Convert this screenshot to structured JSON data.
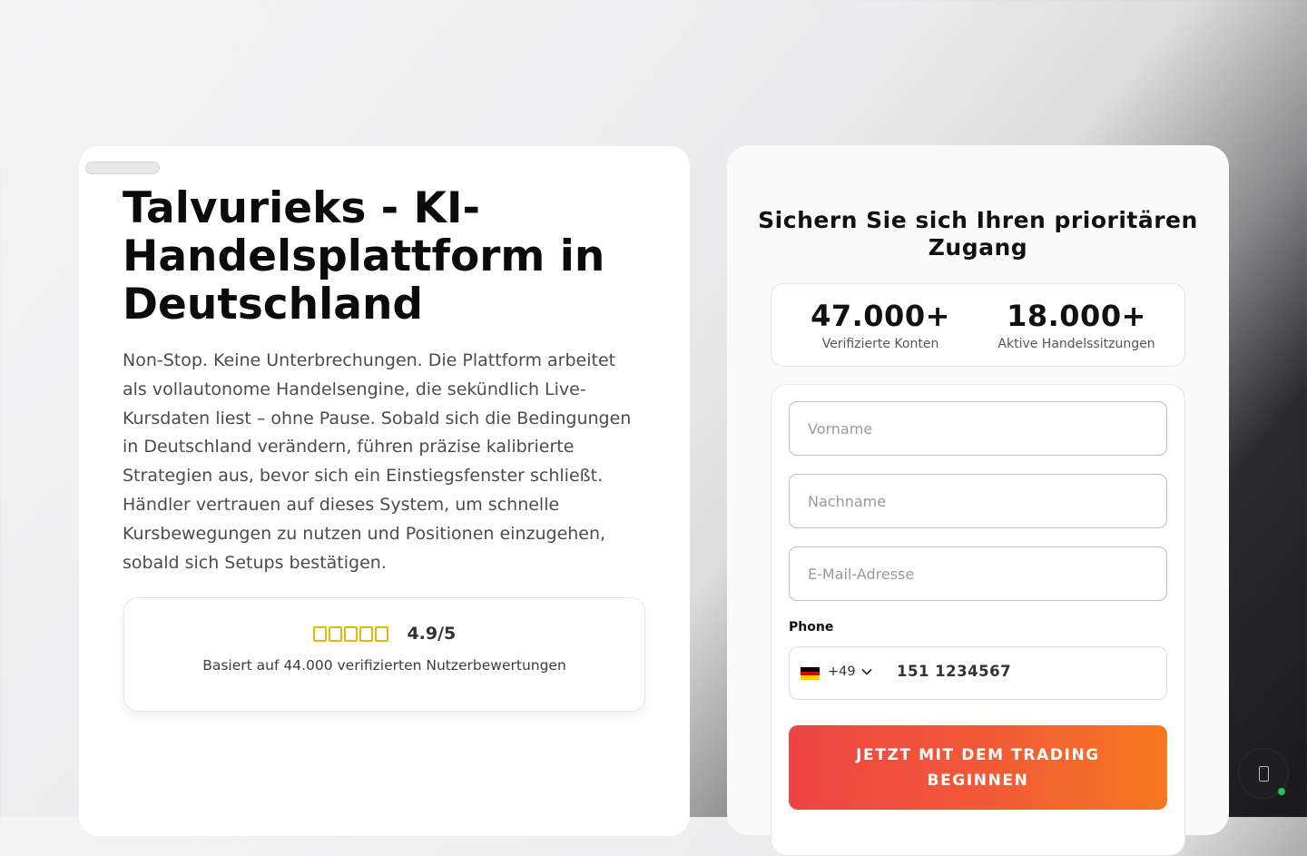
{
  "hero": {
    "title": "Talvurieks - KI-Handelsplattform in Deutschland",
    "description": "Non-Stop. Keine Unterbrechungen. Die Plattform arbeitet als vollautonome Handelsengine, die sekündlich Live-Kursdaten liest – ohne Pause. Sobald sich die Bedingungen in Deutschland verändern, führen präzise kalibrierte Strategien aus, bevor sich ein Einstiegsfenster schließt. Händler vertrauen auf dieses System, um schnelle Kursbewegungen zu nutzen und Positionen einzugehen, sobald sich Setups bestätigen."
  },
  "rating": {
    "score": "4.9/5",
    "stars": 5,
    "subtitle": "Basiert auf 44.000 verifizierten Nutzerbewertungen"
  },
  "form": {
    "title": "Sichern Sie sich Ihren prioritären Zugang",
    "stats": [
      {
        "value": "47.000+",
        "label": "Verifizierte Konten"
      },
      {
        "value": "18.000+",
        "label": "Aktive Handelssitzungen"
      }
    ],
    "first_name_placeholder": "Vorname",
    "last_name_placeholder": "Nachname",
    "email_placeholder": "E-Mail-Adresse",
    "phone_label": "Phone",
    "phone_country_code": "+49",
    "phone_value": "151 1234567",
    "submit_label": "JETZT MIT DEM TRADING BEGINNEN"
  },
  "colors": {
    "cta_start": "#ee4444",
    "cta_end": "#f7781f",
    "star": "#e6b800",
    "online": "#22c55e"
  },
  "icons": {
    "flag": "germany-flag-icon",
    "country_dropdown": "chevron-down-icon",
    "chat": "chat-icon"
  }
}
